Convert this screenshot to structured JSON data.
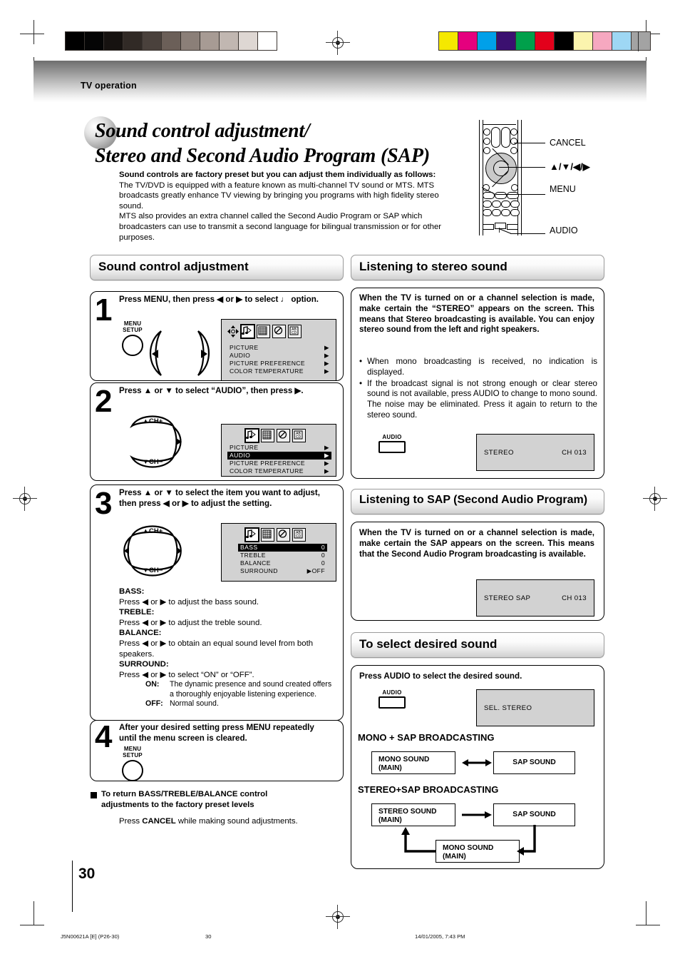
{
  "page": {
    "running_head": "TV operation",
    "page_number": "30",
    "title_line1": "Sound control adjustment/",
    "title_line2": "Stereo and Second Audio Program (SAP)",
    "intro_bold": "Sound controls are factory preset but you can adjust them individually as follows:",
    "intro_body": "The TV/DVD is equipped with a feature known as multi-channel TV sound or MTS. MTS broadcasts greatly enhance TV viewing by bringing you programs with high fidelity stereo sound.\nMTS also provides an extra channel called the Second Audio Program or SAP which broadcasters can use to transmit a second language for bilingual transmission or for other purposes."
  },
  "remote_callouts": [
    {
      "label": "CANCEL"
    },
    {
      "label": "▲/▼/◀/▶"
    },
    {
      "label": "MENU"
    },
    {
      "label": "AUDIO"
    }
  ],
  "sections": {
    "sound_control": "Sound control adjustment",
    "listening_stereo": "Listening to stereo sound",
    "listening_sap": "Listening to SAP (Second Audio Program)",
    "select_sound": "To select desired sound"
  },
  "steps": [
    {
      "num": "1",
      "text": "Press MENU, then press ◀ or ▶ to select ♩ option.",
      "key_label_line1": "MENU",
      "key_label_line2": "SETUP",
      "osd": {
        "rows": [
          {
            "label": "PICTURE",
            "value": "▶",
            "highlight": false
          },
          {
            "label": "AUDIO",
            "value": "▶",
            "highlight": false
          },
          {
            "label": "PICTURE  PREFERENCE",
            "value": "▶",
            "highlight": false
          },
          {
            "label": "COLOR  TEMPERATURE",
            "value": "▶",
            "highlight": false
          }
        ]
      }
    },
    {
      "num": "2",
      "text": "Press ▲ or ▼ to select “AUDIO”, then press ▶.",
      "ch_up": "▲CH+",
      "ch_down": "▼CH−",
      "osd": {
        "rows": [
          {
            "label": "PICTURE",
            "value": "▶",
            "highlight": false
          },
          {
            "label": "AUDIO",
            "value": "▶",
            "highlight": true
          },
          {
            "label": "PICTURE  PREFERENCE",
            "value": "▶",
            "highlight": false
          },
          {
            "label": "COLOR  TEMPERATURE",
            "value": "▶",
            "highlight": false
          }
        ]
      }
    },
    {
      "num": "3",
      "text": "Press ▲ or ▼ to select the item you want to adjust, then press ◀ or ▶ to adjust the setting.",
      "ch_up": "▲CH+",
      "ch_down": "▼CH−",
      "osd": {
        "rows": [
          {
            "label": "BASS",
            "value": "0",
            "highlight": true
          },
          {
            "label": "TREBLE",
            "value": "0",
            "highlight": false
          },
          {
            "label": "BALANCE",
            "value": "0",
            "highlight": false
          },
          {
            "label": "SURROUND",
            "value": "▶OFF",
            "highlight": false
          }
        ]
      }
    },
    {
      "num": "4",
      "text": "After your desired setting press MENU repeatedly until the menu screen is cleared.",
      "key_label_line1": "MENU",
      "key_label_line2": "SETUP"
    }
  ],
  "adjust_descriptions": [
    {
      "term": "BASS:",
      "desc": "Press ◀ or ▶ to adjust the bass sound."
    },
    {
      "term": "TREBLE:",
      "desc": "Press ◀ or ▶ to adjust the treble sound."
    },
    {
      "term": "BALANCE:",
      "desc": "Press ◀ or ▶ to obtain an equal sound level from both speakers."
    },
    {
      "term": "SURROUND:",
      "desc": "Press ◀ or ▶ to select “ON” or “OFF”."
    }
  ],
  "surround_options": [
    {
      "key": "ON:",
      "desc": "The dynamic presence and sound created offers a thoroughly enjoyable listening experience."
    },
    {
      "key": "OFF:",
      "desc": "Normal sound."
    }
  ],
  "reset_note": {
    "heading": "To return BASS/TREBLE/BALANCE control adjustments to the factory preset levels",
    "body_pre": "Press ",
    "body_bold": "CANCEL",
    "body_post": " while making sound adjustments."
  },
  "stereo_panel": {
    "bold": "When the TV is turned on or a channel selection is made, make certain the “STEREO” appears on the screen. This means that Stereo broadcasting is available. You can enjoy stereo sound from the left and right speakers.",
    "bullets": [
      "When mono broadcasting is received, no indication is displayed.",
      "If the broadcast signal is not strong enough or clear stereo sound is not available, press AUDIO to change to mono sound. The noise may be eliminated. Press it again to return to the stereo sound."
    ],
    "audio_key": "AUDIO",
    "osd_left": "STEREO",
    "osd_right": "CH 013"
  },
  "sap_panel": {
    "bold": "When the TV is turned on or a channel selection is made, make certain the SAP appears on the screen. This means that the Second Audio Program broadcasting is available.",
    "osd_left": "STEREO  SAP",
    "osd_right": "CH 013"
  },
  "select_panel": {
    "instruction": "Press AUDIO to select the desired sound.",
    "audio_key": "AUDIO",
    "osd_text": "SEL. STEREO",
    "mono_sap_heading": "MONO + SAP BROADCASTING",
    "mono_sap_boxes": [
      {
        "line1": "MONO SOUND",
        "line2": "(MAIN)"
      },
      {
        "line1": "SAP SOUND",
        "line2": ""
      }
    ],
    "stereo_sap_heading": "STEREO+SAP BROADCASTING",
    "stereo_sap_boxes": [
      {
        "line1": "STEREO SOUND",
        "line2": "(MAIN)"
      },
      {
        "line1": "SAP SOUND",
        "line2": ""
      },
      {
        "line1": "MONO SOUND",
        "line2": "(MAIN)"
      }
    ]
  },
  "footer": {
    "doc_code": "J5N00621A [E] (P26-30)",
    "page": "30",
    "timestamp": "14/01/2005, 7:43 PM"
  },
  "colorbars": {
    "gray_ramp": [
      "#000000",
      "#050505",
      "#161210",
      "#312a26",
      "#4a413c",
      "#6b5f58",
      "#8b7f78",
      "#a79b94",
      "#c1b7b1",
      "#ded7d3",
      "#ffffff"
    ],
    "color_strip": [
      "#f5e800",
      "#e5007e",
      "#00a0e9",
      "#3b1070",
      "#00a04b",
      "#e3001b",
      "#000000",
      "#fbf4ae",
      "#f6a8c0",
      "#9ed7f4",
      "#a3a3a3"
    ]
  }
}
